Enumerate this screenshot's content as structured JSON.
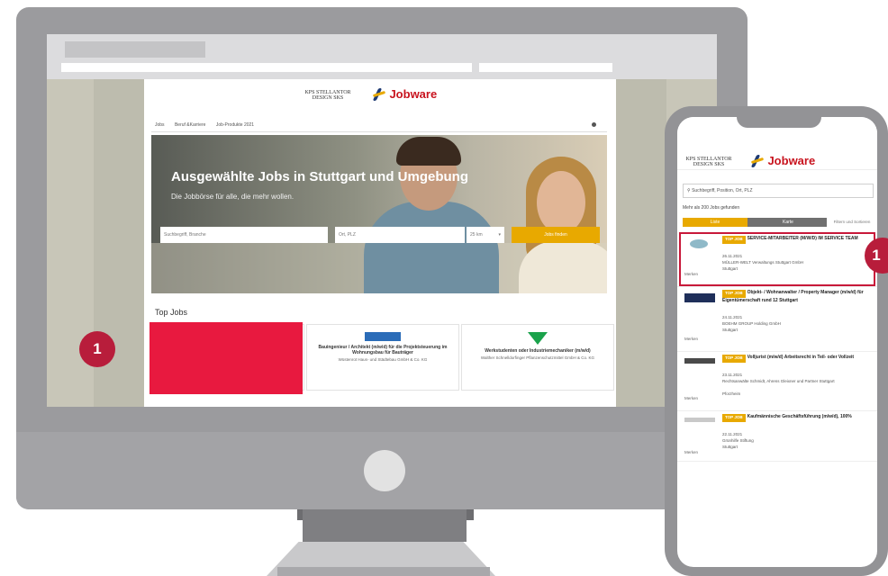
{
  "desktop": {
    "logo_text": "KPS STELLANTOR DESIGN SKS",
    "brand": "Jobware",
    "nav": [
      "Jobs",
      "Beruf &Karriere",
      "Job-Produkte 2021"
    ],
    "hero": {
      "title": "Ausgewählte Jobs in Stuttgart und Umgebung",
      "subtitle": "Die Jobbörse für alle, die mehr wollen.",
      "keyword_placeholder": "Suchbegriff, Branche",
      "location_placeholder": "Ort, PLZ",
      "radius": "25 km",
      "search_button": "Jobs finden"
    },
    "top_jobs_title": "Top Jobs",
    "jobs": [
      {
        "title": "Bauingenieur / Architekt (m/w/d) für die Projektsteuerung im Wohnungsbau für Bauträger",
        "company": "Wüstenrot Haus- und Städtebau GmbH & Co. KG"
      },
      {
        "title": "Werkstudenten oder Industriemechaniker (m/w/d)",
        "company": "Walther Schnelldorfinger Pflanzenschutzmittel GmbH & Co. KG"
      }
    ]
  },
  "callouts": {
    "left": "1",
    "right": "1"
  },
  "mobile": {
    "logo_text": "KPS STELLANTOR DESIGN SKS",
    "brand": "Jobware",
    "search_placeholder": "Suchbegriff, Position, Ort, PLZ",
    "result_count": "Mehr als 200 Jobs gefunden",
    "tab_list": "Liste",
    "tab_map": "Karte",
    "filter_label": "Filtern und Sortieren",
    "save_label": "Merken",
    "items": [
      {
        "badge": "TOP JOB",
        "title": "SERVICE-MITARBEITER (M/W/D) IM SERVICE TEAM",
        "date": "26.11.2021",
        "company": "MÜLLER-WELT Verwaltungs Stuttgart GmbH",
        "location": "Stuttgart"
      },
      {
        "badge": "TOP JOB",
        "title": "Objekt- / Wohnanwalter / Property Manager (m/w/d) für Eigentümerschaft rund 12 Stuttgart",
        "date": "24.11.2021",
        "company": "BOEHM GROUP Holding GmbH",
        "location": "Stuttgart"
      },
      {
        "badge": "TOP JOB",
        "title": "Volljurist (m/w/d) Arbeitsrecht in Teil- oder Vollzeit",
        "date": "23.11.2021",
        "company": "Rechtsanwälte Schmidt, Ahrens Gleixner und Partner Stuttgart",
        "location": "Pforzheim"
      },
      {
        "badge": "TOP JOB",
        "title": "Kaufmännische Geschäftsführung (m/w/d), 100%",
        "date": "22.11.2021",
        "company": "Grünhilfe Stiftung",
        "location": "Stuttgart"
      }
    ]
  }
}
